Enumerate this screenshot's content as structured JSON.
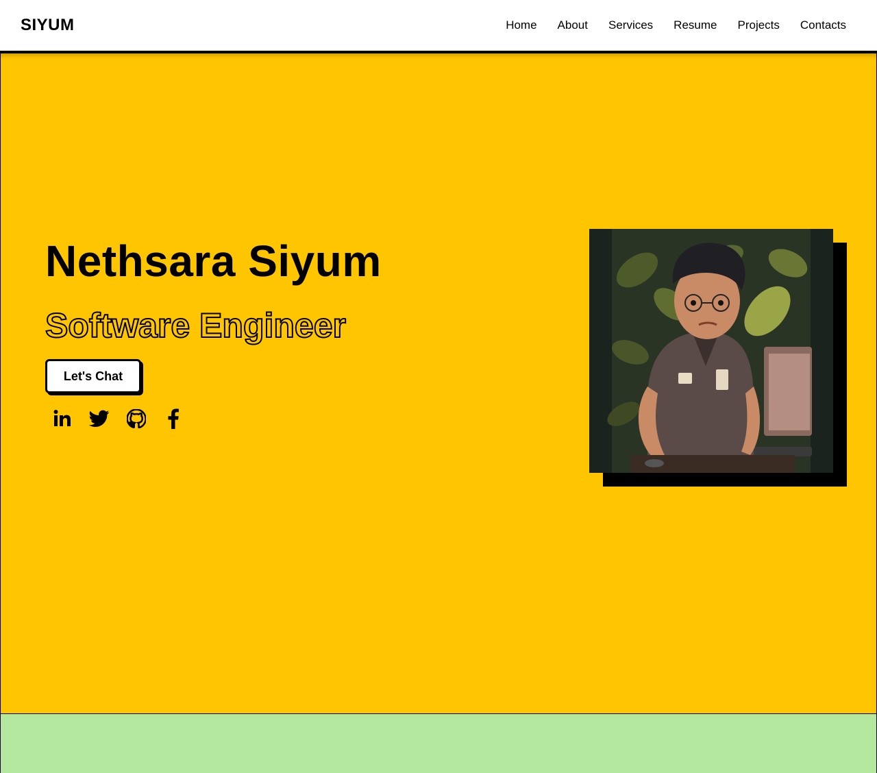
{
  "header": {
    "brand": "SIYUM",
    "nav": [
      {
        "label": "Home"
      },
      {
        "label": "About"
      },
      {
        "label": "Services"
      },
      {
        "label": "Resume"
      },
      {
        "label": "Projects"
      },
      {
        "label": "Contacts"
      }
    ]
  },
  "hero": {
    "name": "Nethsara Siyum",
    "role": "Software Engineer",
    "cta_label": "Let's Chat",
    "socials": [
      {
        "icon": "linkedin-icon"
      },
      {
        "icon": "twitter-icon"
      },
      {
        "icon": "github-icon"
      },
      {
        "icon": "facebook-icon"
      }
    ]
  },
  "colors": {
    "hero_bg": "#FFC600",
    "next_section_bg": "#B3E89E",
    "nav_bg": "#FFFFFF",
    "text": "#000000"
  }
}
